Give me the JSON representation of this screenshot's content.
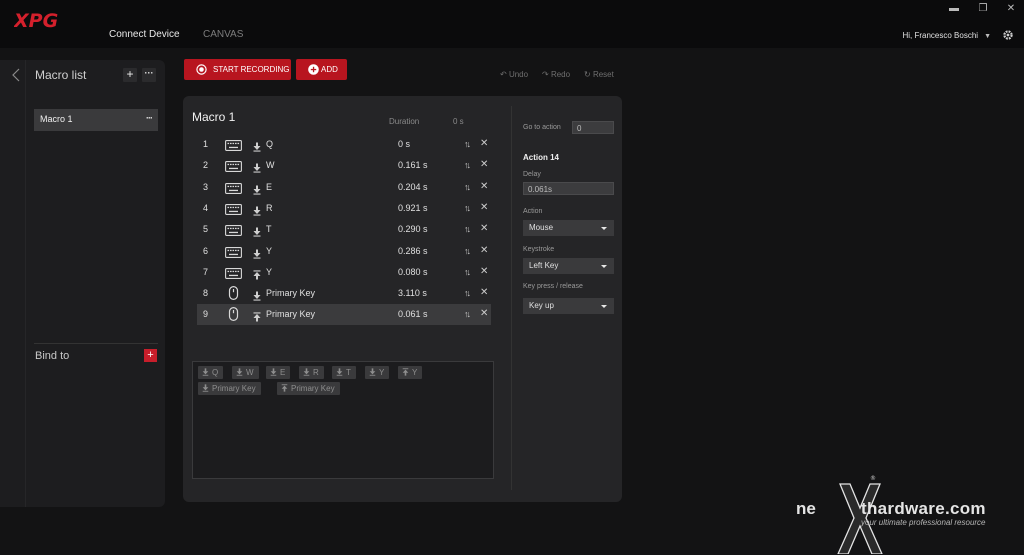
{
  "app": {
    "brand": "XPG",
    "nav": {
      "connect_device": "Connect Device",
      "canvas": "CANVAS"
    },
    "user": "Hi, Francesco Boschi",
    "window_controls": {
      "minimize": "▬",
      "maximize": "❐",
      "close": "✕"
    }
  },
  "left": {
    "macro_list_title": "Macro list",
    "add_label": "+",
    "more_label": "···",
    "items": [
      {
        "label": "Macro 1",
        "more": "···"
      }
    ],
    "bind_title": "Bind to",
    "bind_add": "+"
  },
  "toolbar": {
    "start_recording": "START RECORDING",
    "add": "ADD",
    "undo": "Undo",
    "redo": "Redo",
    "reset": "Reset"
  },
  "macro": {
    "title": "Macro 1",
    "col_duration": "Duration",
    "col_total": "0 s",
    "actions": [
      {
        "num": "1",
        "device": "keyboard",
        "direction": "down",
        "key": "Q",
        "duration": "0 s"
      },
      {
        "num": "2",
        "device": "keyboard",
        "direction": "down",
        "key": "W",
        "duration": "0.161 s"
      },
      {
        "num": "3",
        "device": "keyboard",
        "direction": "down",
        "key": "E",
        "duration": "0.204 s"
      },
      {
        "num": "4",
        "device": "keyboard",
        "direction": "down",
        "key": "R",
        "duration": "0.921 s"
      },
      {
        "num": "5",
        "device": "keyboard",
        "direction": "down",
        "key": "T",
        "duration": "0.290 s"
      },
      {
        "num": "6",
        "device": "keyboard",
        "direction": "down",
        "key": "Y",
        "duration": "0.286 s"
      },
      {
        "num": "7",
        "device": "keyboard",
        "direction": "up",
        "key": "Y",
        "duration": "0.080 s"
      },
      {
        "num": "8",
        "device": "mouse",
        "direction": "down",
        "key": "Primary Key",
        "duration": "3.110 s"
      },
      {
        "num": "9",
        "device": "mouse",
        "direction": "up",
        "key": "Primary Key",
        "duration": "0.061 s"
      }
    ],
    "swap_label": "↑↓",
    "delete_label": "✕",
    "preview_chips": [
      {
        "dir": "down",
        "label": "Q"
      },
      {
        "dir": "down",
        "label": "W"
      },
      {
        "dir": "down",
        "label": "E"
      },
      {
        "dir": "down",
        "label": "R"
      },
      {
        "dir": "down",
        "label": "T"
      },
      {
        "dir": "down",
        "label": "Y"
      },
      {
        "dir": "up",
        "label": "Y"
      },
      {
        "dir": "down",
        "label": "Primary Key"
      },
      {
        "dir": "up",
        "label": "Primary Key"
      }
    ]
  },
  "settings": {
    "goto_label": "Go to action",
    "goto_value": "0",
    "action_title": "Action 14",
    "delay_label": "Delay",
    "delay_value": "0.061s",
    "action_label": "Action",
    "action_value": "Mouse",
    "keystroke_label": "Keystroke",
    "keystroke_value": "Left Key",
    "press_label": "Key press / release",
    "press_value": "Key up"
  },
  "watermark": {
    "brand_ne": "ne",
    "brand_rest": "thardware.com",
    "tagline": "your ultimate professional resource",
    "registered": "®"
  },
  "colors": {
    "accent": "#b8151f",
    "bg": "#131314",
    "panel": "#252527"
  }
}
